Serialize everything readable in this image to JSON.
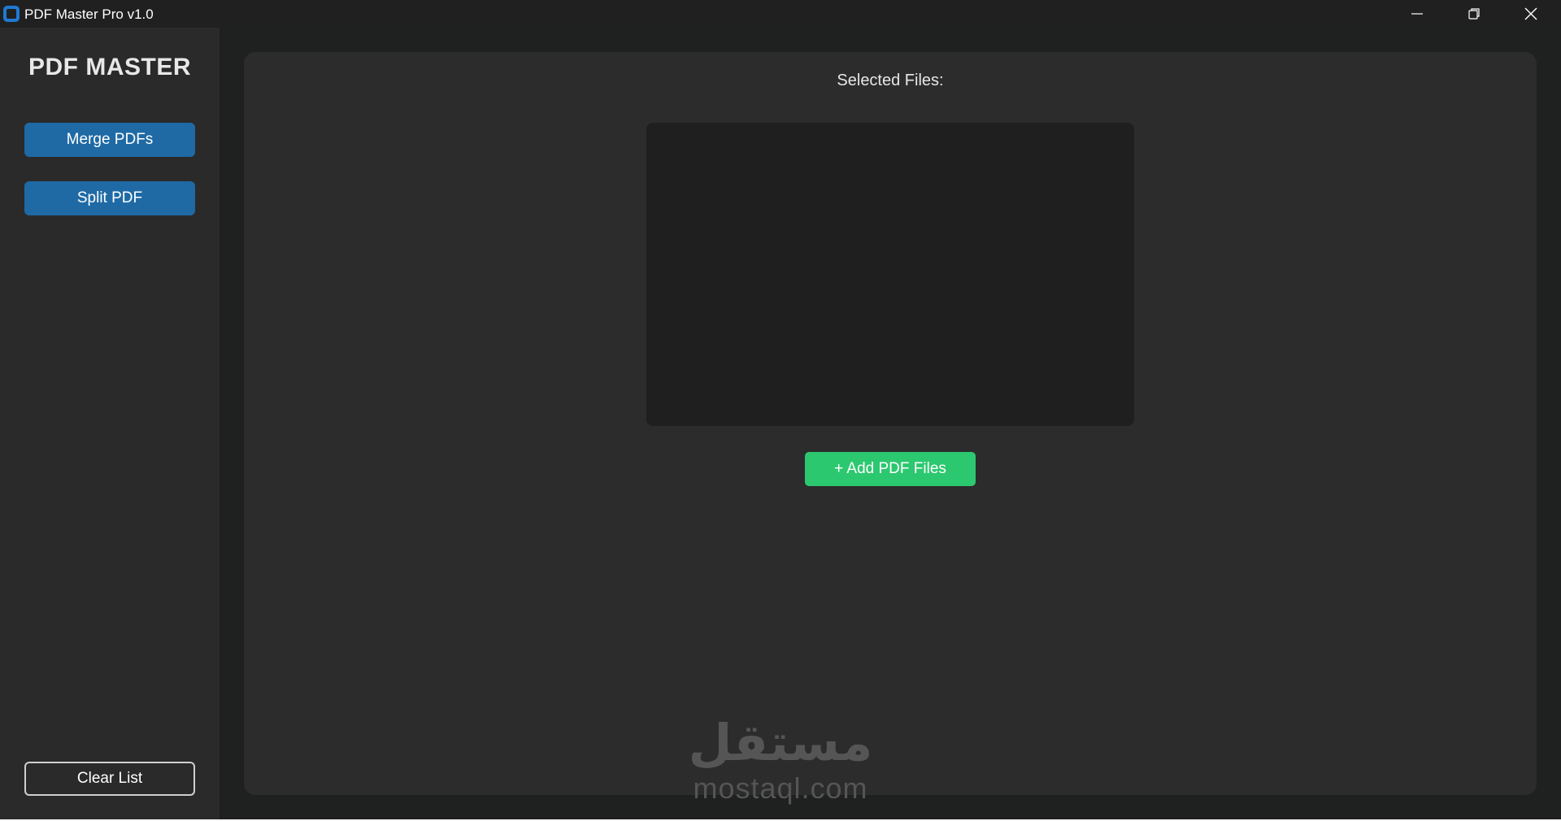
{
  "window": {
    "title": "PDF Master Pro v1.0",
    "controls": {
      "minimize_icon": "minimize-icon",
      "maximize_icon": "restore-icon",
      "close_icon": "close-icon"
    }
  },
  "sidebar": {
    "title": "PDF MASTER",
    "buttons": {
      "merge": "Merge PDFs",
      "split": "Split PDF",
      "clear": "Clear List"
    }
  },
  "main": {
    "selected_files_label": "Selected Files:",
    "files": [],
    "add_button": "+ Add PDF Files"
  },
  "watermark": {
    "arabic": "مستقل",
    "latin": "mostaql.com"
  },
  "colors": {
    "accent_blue": "#1f6aa5",
    "accent_green": "#2cc870",
    "background": "#2a2a2a",
    "panel": "#2c2c2c",
    "list_bg": "#1e1f1e"
  }
}
